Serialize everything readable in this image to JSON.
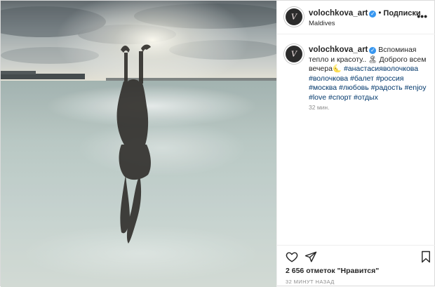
{
  "header": {
    "username": "volochkova_art",
    "verified_mark": "✓",
    "separator": "•",
    "follow_label": "Подписки",
    "location": "Maldives",
    "more_label": "•••"
  },
  "post": {
    "avatar_text": "V"
  },
  "caption": {
    "username": "volochkova_art",
    "text": "Вспоминая тепло и красоту.. 🏝 Доброго всем вечера🌜",
    "hashtags": [
      "#анастасияволочкова",
      "#волочкова",
      "#балет",
      "#россия",
      "#москва",
      "#любовь",
      "#радость",
      "#enjoy",
      "#love",
      "#спорт",
      "#отдых"
    ],
    "time": "32 мин."
  },
  "actions": {
    "like_icon": "heart-icon",
    "share_icon": "paper-plane-icon",
    "save_icon": "bookmark-icon"
  },
  "likes_text": "2 656 отметок \"Нравится\"",
  "ago_text": "32 МИНУТ НАЗАД",
  "colors": {
    "link": "#00376b",
    "verified": "#3897f0",
    "muted": "#8e8e8e",
    "border": "#dbdbdb"
  }
}
